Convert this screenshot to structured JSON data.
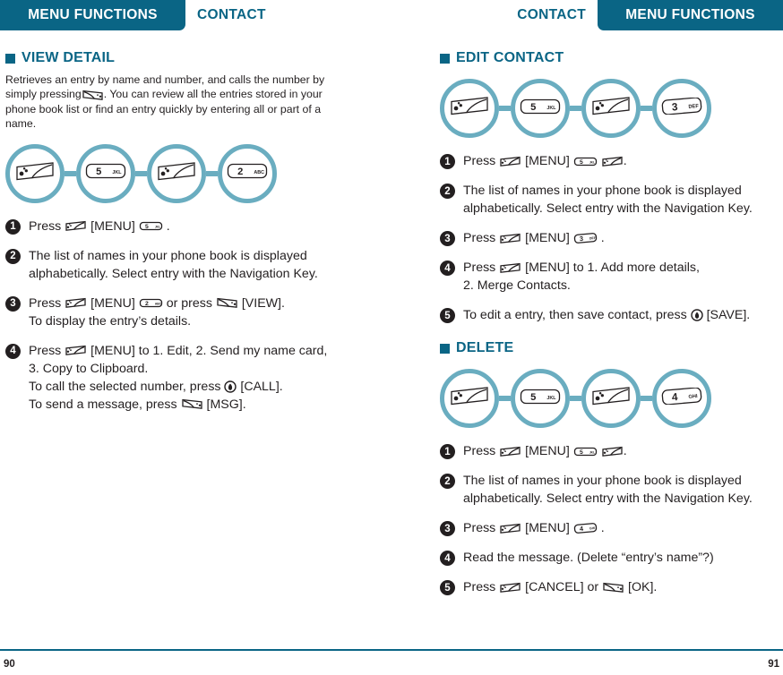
{
  "header": {
    "left_pill": "MENU FUNCTIONS",
    "left_plain": "CONTACT",
    "right_plain": "CONTACT",
    "right_pill": "MENU FUNCTIONS"
  },
  "colors": {
    "teal": "#0a6585",
    "ring": "#6aadc0",
    "text": "#231f20"
  },
  "left_column": {
    "section_title": "VIEW DETAIL",
    "intro": "Retrieves an entry by name and number, and calls the number by simply pressing    . You can review all the entries stored in your phone book list or find an entry quickly by entering all or part of a name.",
    "intro_part1": "Retrieves an entry by name and number, and calls the number by simply pressing",
    "intro_part2": ". You can review all the entries stored in your phone book list or find an entry quickly by entering all or part of a name.",
    "flow": [
      {
        "icon": "menu-softkey-icon",
        "label": ""
      },
      {
        "icon": "keypad-key-icon",
        "label": "5 JKL"
      },
      {
        "icon": "menu-softkey-icon",
        "label": ""
      },
      {
        "icon": "keypad-key-icon",
        "label": "2 ABC"
      }
    ],
    "steps": [
      {
        "num": "1",
        "lines": [
          [
            {
              "t": "Press "
            },
            {
              "icon": "menu-softkey-icon"
            },
            {
              "t": " [MENU] "
            },
            {
              "icon": "key-5-jkl-icon"
            },
            {
              "t": " ."
            }
          ]
        ]
      },
      {
        "num": "2",
        "lines": [
          [
            {
              "t": "The list of names in your phone book is displayed"
            }
          ],
          [
            {
              "t": "alphabetically. Select entry with the Navigation Key."
            }
          ]
        ]
      },
      {
        "num": "3",
        "lines": [
          [
            {
              "t": "Press "
            },
            {
              "icon": "menu-softkey-icon"
            },
            {
              "t": " [MENU] "
            },
            {
              "icon": "key-2-abc-icon"
            },
            {
              "t": " or press "
            },
            {
              "icon": "send-softkey-icon"
            },
            {
              "t": " [VIEW]."
            }
          ],
          [
            {
              "t": "To display the entry’s details."
            }
          ]
        ]
      },
      {
        "num": "4",
        "lines": [
          [
            {
              "t": "Press "
            },
            {
              "icon": "menu-softkey-icon"
            },
            {
              "t": " [MENU] to 1. Edit, 2. Send my name card,"
            }
          ],
          [
            {
              "t": "3. Copy to Clipboard."
            }
          ],
          [
            {
              "t": "To call the selected number, press "
            },
            {
              "icon": "call-center-key-icon"
            },
            {
              "t": " [CALL]."
            }
          ],
          [
            {
              "t": "To send a message, press "
            },
            {
              "icon": "send-softkey-icon"
            },
            {
              "t": " [MSG]."
            }
          ]
        ]
      }
    ]
  },
  "right_column": {
    "sections": [
      {
        "section_title": "EDIT CONTACT",
        "flow": [
          {
            "icon": "menu-softkey-icon",
            "label": ""
          },
          {
            "icon": "keypad-key-icon",
            "label": "5 JKL"
          },
          {
            "icon": "menu-softkey-icon",
            "label": ""
          },
          {
            "icon": "keypad-key-tilt-icon",
            "label": "3 DEF"
          }
        ],
        "steps": [
          {
            "num": "1",
            "lines": [
              [
                {
                  "t": "Press "
                },
                {
                  "icon": "menu-softkey-icon"
                },
                {
                  "t": " [MENU] "
                },
                {
                  "icon": "key-5-jkl-icon"
                },
                {
                  "t": "  "
                },
                {
                  "icon": "menu-softkey-icon"
                },
                {
                  "t": "."
                }
              ]
            ]
          },
          {
            "num": "2",
            "lines": [
              [
                {
                  "t": "The list of names in your phone book is displayed"
                }
              ],
              [
                {
                  "t": "alphabetically. Select entry with the Navigation Key."
                }
              ]
            ]
          },
          {
            "num": "3",
            "lines": [
              [
                {
                  "t": "Press "
                },
                {
                  "icon": "menu-softkey-icon"
                },
                {
                  "t": " [MENU] "
                },
                {
                  "icon": "key-3-def-icon"
                },
                {
                  "t": " ."
                }
              ]
            ]
          },
          {
            "num": "4",
            "lines": [
              [
                {
                  "t": "Press "
                },
                {
                  "icon": "menu-softkey-icon"
                },
                {
                  "t": " [MENU] to 1. Add more details,"
                }
              ],
              [
                {
                  "t": "2. Merge Contacts."
                }
              ]
            ]
          },
          {
            "num": "5",
            "lines": [
              [
                {
                  "t": "To edit a entry, then save contact, press "
                },
                {
                  "icon": "call-center-key-icon"
                },
                {
                  "t": "  [SAVE]."
                }
              ]
            ]
          }
        ]
      },
      {
        "section_title": "DELETE",
        "flow": [
          {
            "icon": "menu-softkey-icon",
            "label": ""
          },
          {
            "icon": "keypad-key-icon",
            "label": "5 JKL"
          },
          {
            "icon": "menu-softkey-icon",
            "label": ""
          },
          {
            "icon": "keypad-key-tilt-icon",
            "label": "4 GHI"
          }
        ],
        "steps": [
          {
            "num": "1",
            "lines": [
              [
                {
                  "t": "Press "
                },
                {
                  "icon": "menu-softkey-icon"
                },
                {
                  "t": " [MENU] "
                },
                {
                  "icon": "key-5-jkl-icon"
                },
                {
                  "t": "  "
                },
                {
                  "icon": "menu-softkey-icon"
                },
                {
                  "t": "."
                }
              ]
            ]
          },
          {
            "num": "2",
            "lines": [
              [
                {
                  "t": "The list of names in your phone book is displayed"
                }
              ],
              [
                {
                  "t": "alphabetically. Select entry with the Navigation Key."
                }
              ]
            ]
          },
          {
            "num": "3",
            "lines": [
              [
                {
                  "t": "Press "
                },
                {
                  "icon": "menu-softkey-icon"
                },
                {
                  "t": " [MENU] "
                },
                {
                  "icon": "key-4-ghi-icon"
                },
                {
                  "t": " ."
                }
              ]
            ]
          },
          {
            "num": "4",
            "lines": [
              [
                {
                  "t": "Read the message. (Delete “entry’s name”?)"
                }
              ]
            ]
          },
          {
            "num": "5",
            "lines": [
              [
                {
                  "t": "Press "
                },
                {
                  "icon": "menu-softkey-icon"
                },
                {
                  "t": " [CANCEL] or "
                },
                {
                  "icon": "send-softkey-icon"
                },
                {
                  "t": " [OK]."
                }
              ]
            ]
          }
        ]
      }
    ]
  },
  "footer": {
    "page_left": "90",
    "page_right": "91"
  }
}
